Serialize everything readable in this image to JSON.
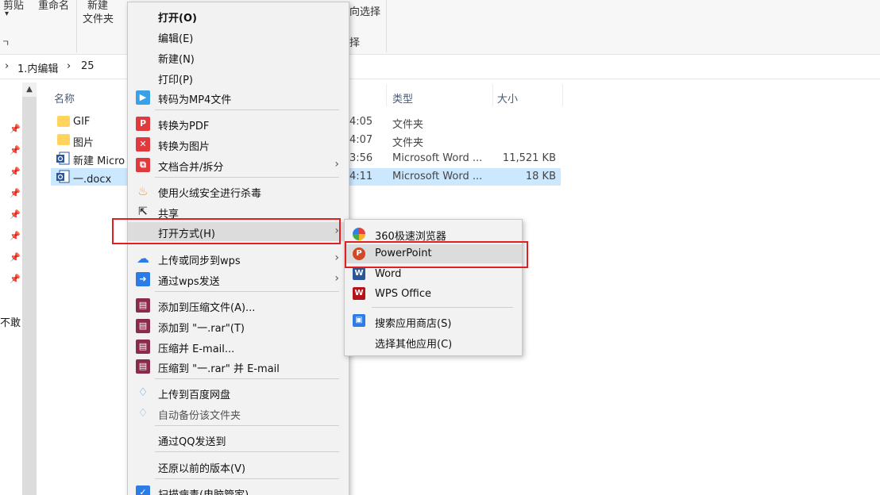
{
  "ribbon": {
    "group1": "剪贴",
    "group2": "重命名",
    "group3_line1": "新建",
    "group3_line2": "文件夹",
    "group4": "向选择",
    "group5": "择",
    "left_edge": "ㄱ"
  },
  "address": {
    "part1": "1.内编辑",
    "part2": "25",
    "chevron": "›"
  },
  "columns": {
    "name": "名称",
    "type": "类型",
    "size": "大小"
  },
  "files": [
    {
      "name": "GIF",
      "time": "4:05",
      "type": "文件夹",
      "size": ""
    },
    {
      "name": "图片",
      "time": "4:07",
      "type": "文件夹",
      "size": ""
    },
    {
      "name": "新建 Micro",
      "time": "3:56",
      "type": "Microsoft Word ...",
      "size": "11,521 KB"
    },
    {
      "name": "一.docx",
      "time": "4:11",
      "type": "Microsoft Word ...",
      "size": "18 KB"
    }
  ],
  "side_text": "不敢",
  "context_menu": {
    "open": "打开(O)",
    "edit": "编辑(E)",
    "new": "新建(N)",
    "print": "打印(P)",
    "to_mp4": "转码为MP4文件",
    "to_pdf": "转换为PDF",
    "to_image": "转换为图片",
    "merge_split": "文档合并/拆分",
    "antivirus": "使用火绒安全进行杀毒",
    "share": "共享",
    "open_with": "打开方式(H)",
    "upload_wps": "上传或同步到wps",
    "send_wps": "通过wps发送",
    "add_archive": "添加到压缩文件(A)...",
    "add_rar": "添加到 \"一.rar\"(T)",
    "compress_email": "压缩并 E-mail...",
    "compress_rar_email": "压缩到 \"一.rar\" 并 E-mail",
    "upload_baidu": "上传到百度网盘",
    "auto_backup": "自动备份该文件夹",
    "send_qq": "通过QQ发送到",
    "restore": "还原以前的版本(V)",
    "scan": "扫描病毒(电脑管家)"
  },
  "open_with_menu": {
    "browser360": "360极速浏览器",
    "powerpoint": "PowerPoint",
    "word": "Word",
    "wps": "WPS Office",
    "store": "搜索应用商店(S)",
    "other": "选择其他应用(C)"
  },
  "colors": {
    "highlight_box": "#e02020",
    "selection": "#cce8ff",
    "menu_bg": "#f2f2f2"
  }
}
